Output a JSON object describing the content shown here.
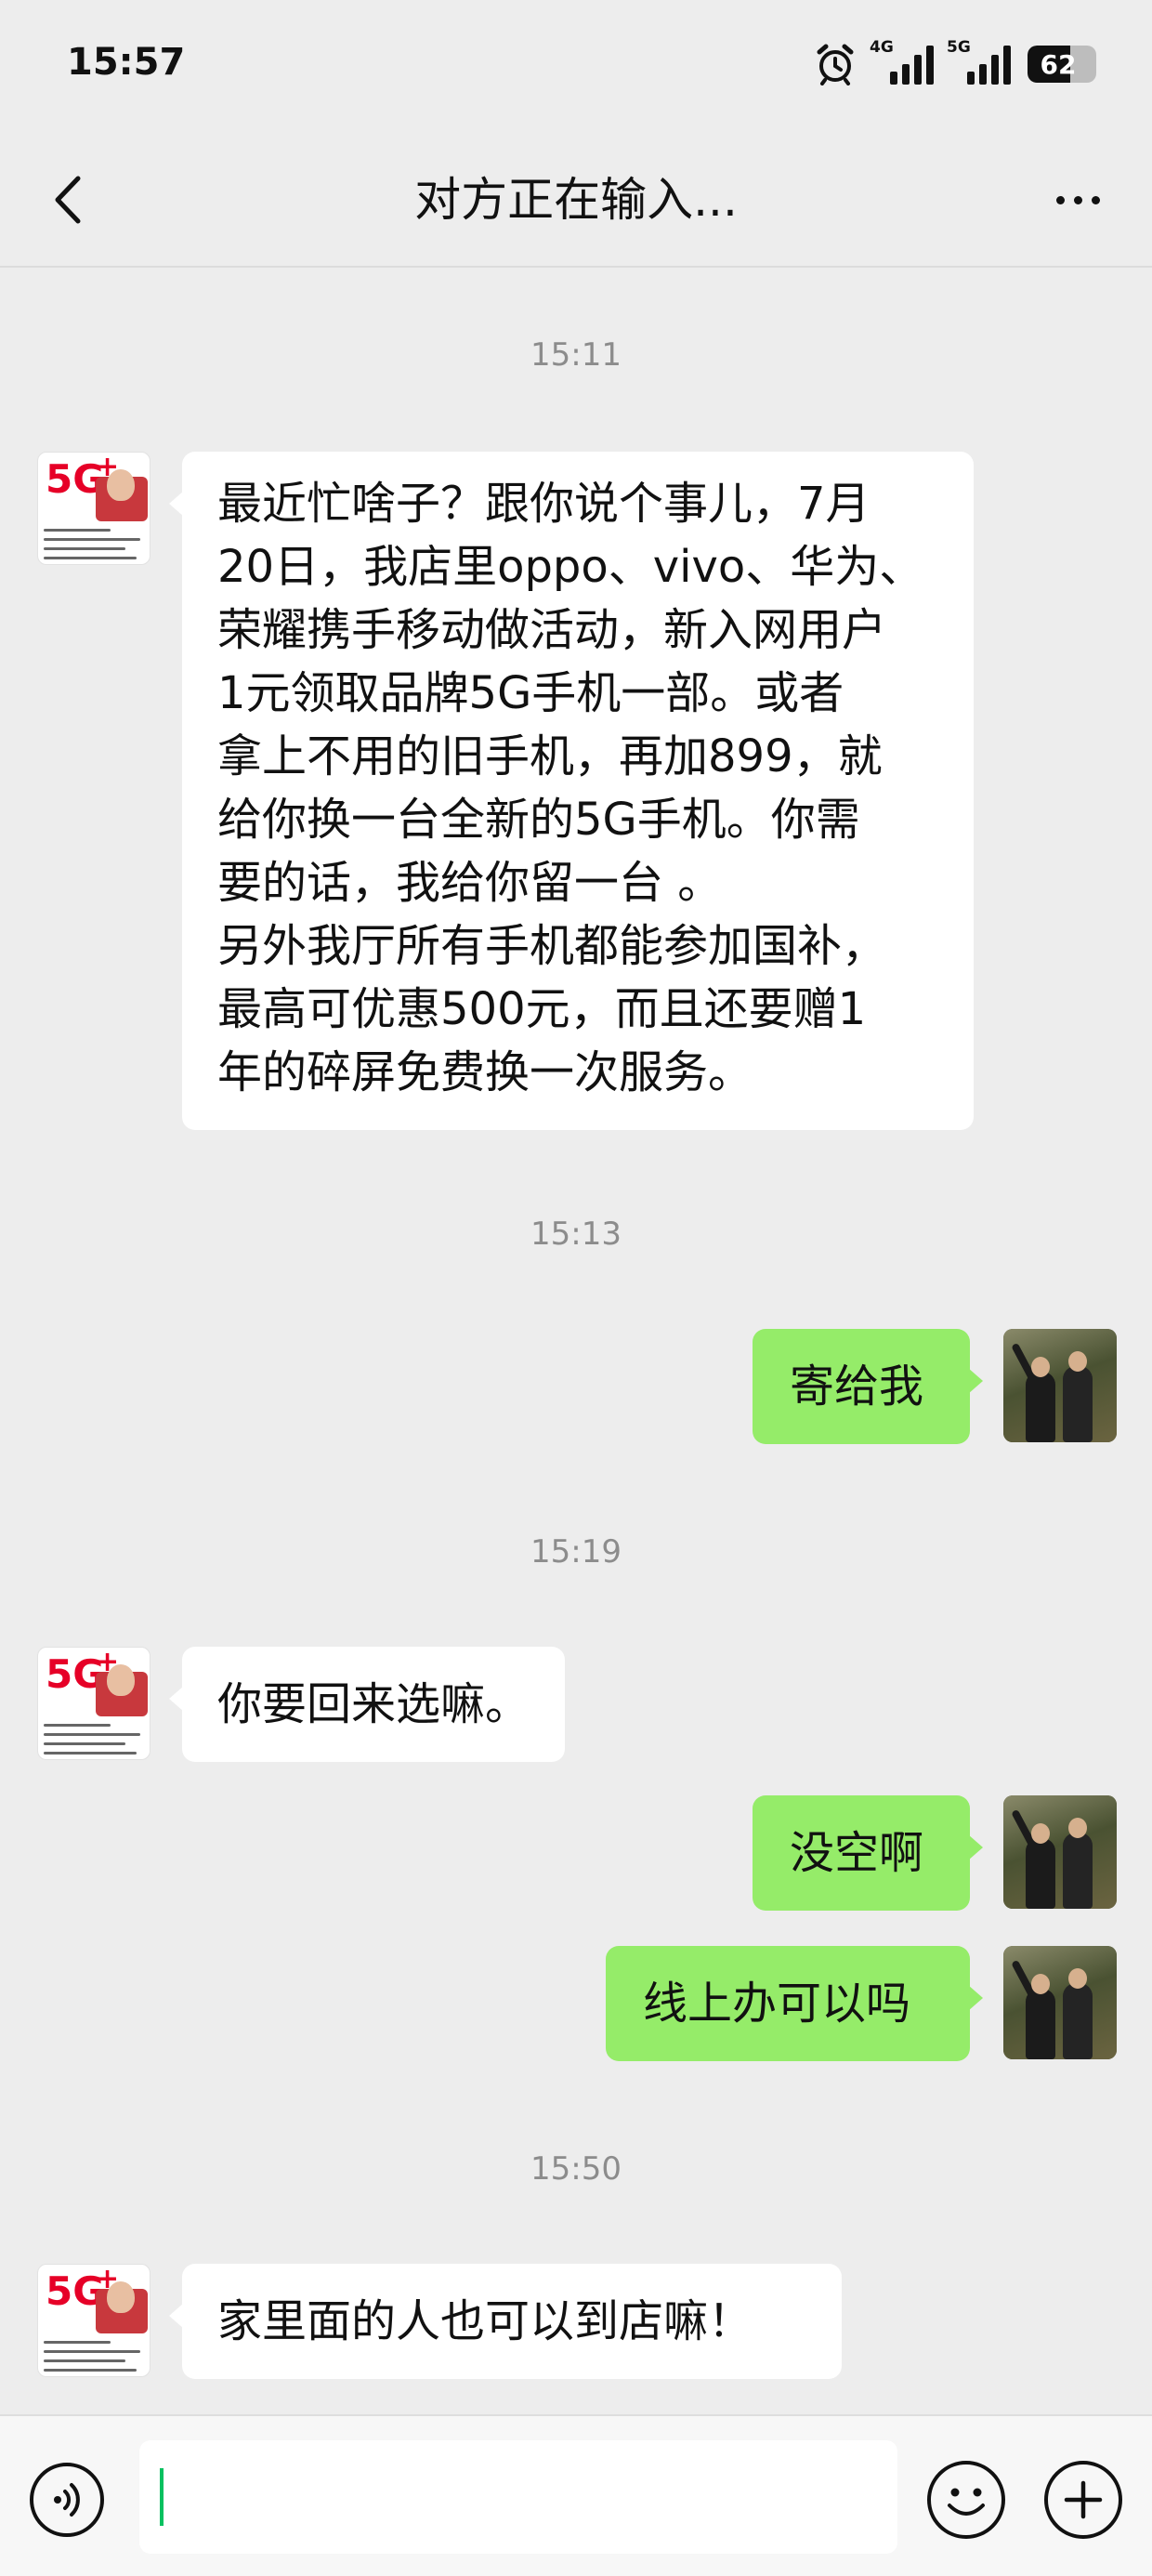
{
  "status_bar": {
    "time": "15:57",
    "network1": "4G",
    "network2": "5G",
    "battery_percent": "62",
    "icons": [
      "alarm-icon",
      "signal-4g-icon",
      "signal-5g-icon",
      "battery-icon"
    ]
  },
  "header": {
    "title": "对方正在输入...",
    "back_icon": "chevron-left-icon",
    "more_icon": "more-horizontal-icon"
  },
  "messages": [
    {
      "type": "timestamp",
      "text": "15:11"
    },
    {
      "type": "incoming",
      "sender": "store",
      "text": "最近忙啥子？跟你说个事儿，7月\n20日，我店里oppo、vivo、华为、\n荣耀携手移动做活动，新入网用户\n1元领取品牌5G手机一部。或者\n拿上不用的旧手机，再加899，就\n给你换一台全新的5G手机。你需\n要的话，我给你留一台 。\n另外我厅所有手机都能参加国补，\n最高可优惠500元，而且还要赠1\n年的碎屏免费换一次服务。"
    },
    {
      "type": "timestamp",
      "text": "15:13"
    },
    {
      "type": "outgoing",
      "sender": "me",
      "text": "寄给我"
    },
    {
      "type": "timestamp",
      "text": "15:19"
    },
    {
      "type": "incoming",
      "sender": "store",
      "text": "你要回来选嘛。"
    },
    {
      "type": "outgoing",
      "sender": "me",
      "text": "没空啊"
    },
    {
      "type": "outgoing",
      "sender": "me",
      "text": "线上办可以吗"
    },
    {
      "type": "timestamp",
      "text": "15:50"
    },
    {
      "type": "incoming",
      "sender": "store",
      "text": "家里面的人也可以到店嘛！"
    }
  ],
  "store_avatar": {
    "badge": "5G",
    "badge_plus": "+"
  },
  "input_bar": {
    "value": "",
    "icons": [
      "voice-icon",
      "emoji-icon",
      "plus-icon"
    ]
  },
  "colors": {
    "background": "#ededed",
    "outgoing_bubble": "#95ec69",
    "incoming_bubble": "#ffffff",
    "caret": "#07c160"
  }
}
